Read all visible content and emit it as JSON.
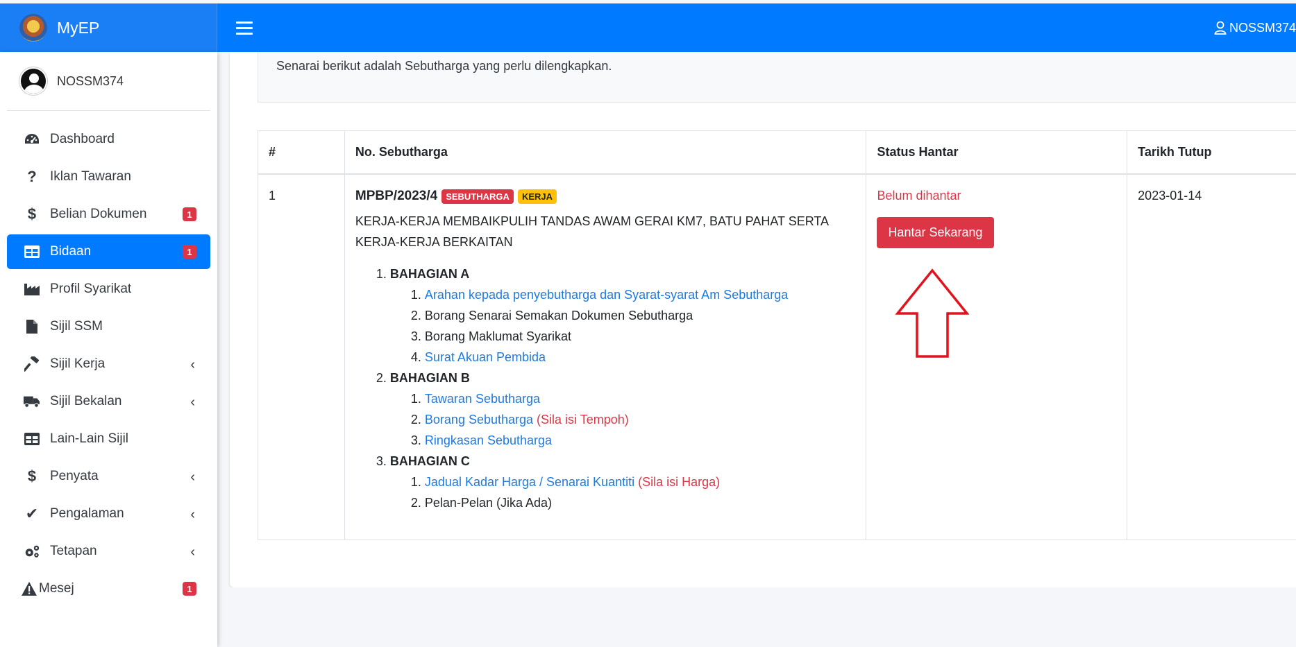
{
  "brand": {
    "name": "MyEP"
  },
  "topbar": {
    "user": "NOSSM374"
  },
  "sidebar": {
    "user": "NOSSM374",
    "items": [
      {
        "label": "Dashboard",
        "icon": "gauge-icon"
      },
      {
        "label": "Iklan Tawaran",
        "icon": "question-icon"
      },
      {
        "label": "Belian Dokumen",
        "icon": "dollar-icon",
        "badge": "1"
      },
      {
        "label": "Bidaan",
        "icon": "table-icon",
        "badge": "1",
        "active": true
      },
      {
        "label": "Profil Syarikat",
        "icon": "industry-icon"
      },
      {
        "label": "Sijil SSM",
        "icon": "file-icon"
      },
      {
        "label": "Sijil Kerja",
        "icon": "hammer-icon",
        "chevron": true
      },
      {
        "label": "Sijil Bekalan",
        "icon": "truck-icon",
        "chevron": true
      },
      {
        "label": "Lain-Lain Sijil",
        "icon": "table-icon"
      },
      {
        "label": "Penyata",
        "icon": "dollar-icon",
        "chevron": true
      },
      {
        "label": "Pengalaman",
        "icon": "check-icon",
        "chevron": true
      },
      {
        "label": "Tetapan",
        "icon": "gears-icon",
        "chevron": true
      },
      {
        "label": "Mesej",
        "icon": "warning-icon",
        "badge": "1"
      }
    ]
  },
  "main": {
    "intro": "Senarai berikut adalah Sebutharga yang perlu dilengkapkan.",
    "table": {
      "headers": [
        "#",
        "No. Sebutharga",
        "Status Hantar",
        "Tarikh Tutup"
      ],
      "row": {
        "index": "1",
        "ref": "MPBP/2023/4",
        "tag1": "SEBUTHARGA",
        "tag2": "KERJA",
        "desc": "KERJA-KERJA MEMBAIKPULIH TANDAS AWAM GERAI KM7, BATU PAHAT SERTA KERJA-KERJA BERKAITAN",
        "sections": {
          "a": {
            "title": "BAHAGIAN A",
            "items": [
              "Arahan kepada penyebutharga dan Syarat-syarat Am Sebutharga",
              "Borang Senarai Semakan Dokumen Sebutharga",
              "Borang Maklumat Syarikat",
              "Surat Akuan Pembida"
            ]
          },
          "b": {
            "title": "BAHAGIAN B",
            "items": [
              "Tawaran Sebutharga",
              "Borang Sebutharga",
              "Ringkasan Sebutharga"
            ],
            "note": "(Sila isi Tempoh)"
          },
          "c": {
            "title": "BAHAGIAN C",
            "items": [
              "Jadual Kadar Harga / Senarai Kuantiti",
              "Pelan-Pelan (Jika Ada)"
            ],
            "note": "(Sila isi Harga)"
          }
        },
        "status": "Belum dihantar",
        "button": "Hantar Sekarang",
        "close_date": "2023-01-14"
      }
    }
  },
  "colors": {
    "primary": "#007bff",
    "danger": "#dc3545",
    "warning": "#ffc107",
    "link": "#1f7ae0"
  }
}
